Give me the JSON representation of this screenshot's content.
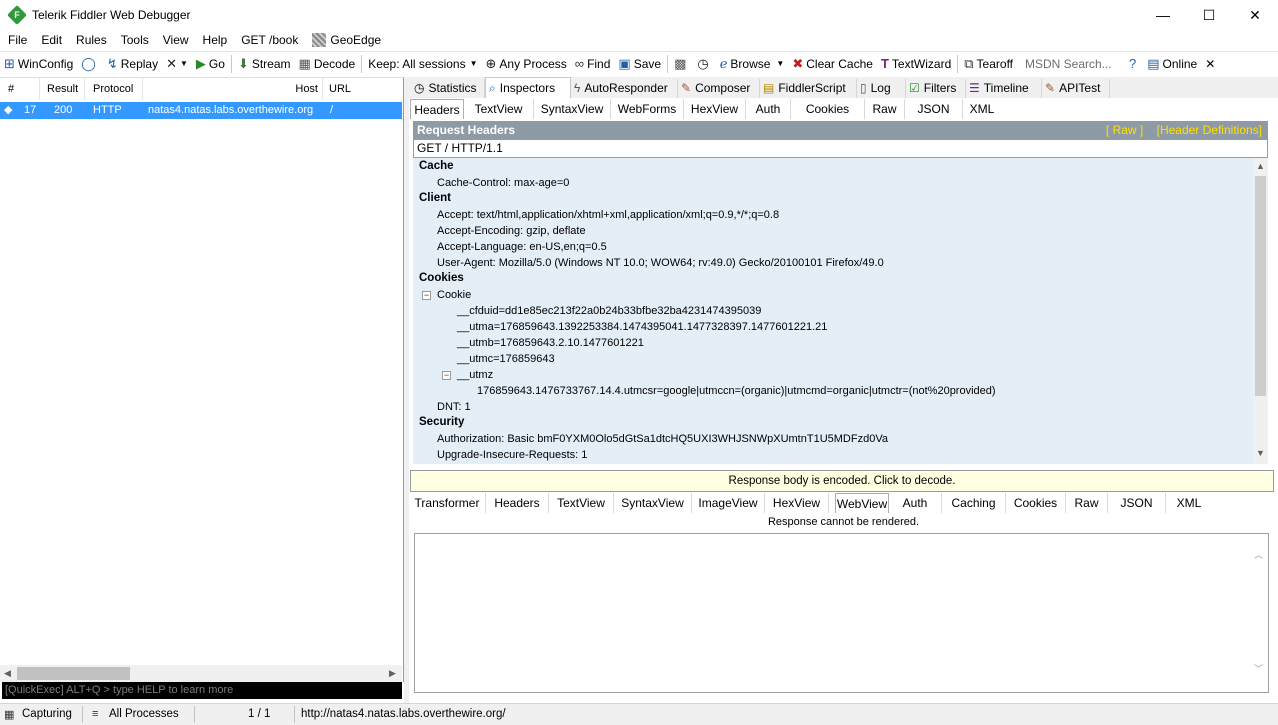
{
  "window": {
    "title": "Telerik Fiddler Web Debugger",
    "logo_letter": "F",
    "minimize": "—",
    "maximize": "☐",
    "close": "✕"
  },
  "menu": [
    "File",
    "Edit",
    "Rules",
    "Tools",
    "View",
    "Help",
    "GET /book",
    "GeoEdge"
  ],
  "toolbar": {
    "winconfig": "WinConfig",
    "replay": "Replay",
    "go": "Go",
    "stream": "Stream",
    "decode": "Decode",
    "keep": "Keep: All sessions",
    "any_process": "Any Process",
    "find": "Find",
    "save": "Save",
    "browse": "Browse",
    "clear_cache": "Clear Cache",
    "textwizard": "TextWizard",
    "tearoff": "Tearoff",
    "msdn_placeholder": "MSDN Search...",
    "online": "Online"
  },
  "sessions": {
    "columns": [
      "#",
      "Result",
      "Protocol",
      "Host",
      "URL"
    ],
    "rows": [
      {
        "num": "17",
        "result": "200",
        "protocol": "HTTP",
        "host": "natas4.natas.labs.overthewire.org",
        "url": "/"
      }
    ]
  },
  "quickexec": "[QuickExec] ALT+Q > type HELP to learn more",
  "status": {
    "capturing": "Capturing",
    "processes": "All Processes",
    "count": "1 / 1",
    "url": "http://natas4.natas.labs.overthewire.org/"
  },
  "main_tabs": [
    "Statistics",
    "Inspectors",
    "AutoResponder",
    "Composer",
    "FiddlerScript",
    "Log",
    "Filters",
    "Timeline",
    "APITest"
  ],
  "request_tabs": [
    "Headers",
    "TextView",
    "SyntaxView",
    "WebForms",
    "HexView",
    "Auth",
    "Cookies",
    "Raw",
    "JSON",
    "XML"
  ],
  "request": {
    "section_title": "Request Headers",
    "raw_link": "[ Raw ]",
    "defs_link": "[Header Definitions]",
    "request_line": "GET / HTTP/1.1",
    "groups": {
      "cache": "Cache",
      "client": "Client",
      "cookies": "Cookies",
      "security": "Security"
    },
    "lines": {
      "cache_control": "Cache-Control: max-age=0",
      "accept": "Accept: text/html,application/xhtml+xml,application/xml;q=0.9,*/*;q=0.8",
      "accept_encoding": "Accept-Encoding: gzip, deflate",
      "accept_language": "Accept-Language: en-US,en;q=0.5",
      "user_agent": "User-Agent: Mozilla/5.0 (Windows NT 10.0; WOW64; rv:49.0) Gecko/20100101 Firefox/49.0",
      "cookie": "Cookie",
      "cfduid": "__cfduid=dd1e85ec213f22a0b24b33bfbe32ba4231474395039",
      "utma": "__utma=176859643.1392253384.1474395041.1477328397.1477601221.21",
      "utmb": "__utmb=176859643.2.10.1477601221",
      "utmc": "__utmc=176859643",
      "utmz": "__utmz",
      "utmz_value": "176859643.1476733767.14.4.utmcsr=google|utmccn=(organic)|utmcmd=organic|utmctr=(not%20provided)",
      "dnt": "DNT: 1",
      "authorization": "Authorization: Basic bmF0YXM0Olo5dGtSa1dtcHQ5UXI3WHJSNWpXUmtnT1U5MDFzd0Va",
      "upgrade": "Upgrade-Insecure-Requests: 1"
    }
  },
  "response": {
    "encoded_notice": "Response body is encoded. Click to decode.",
    "tabs": [
      "Transformer",
      "Headers",
      "TextView",
      "SyntaxView",
      "ImageView",
      "HexView",
      "WebView",
      "Auth",
      "Caching",
      "Cookies",
      "Raw",
      "JSON",
      "XML"
    ],
    "cannot_render": "Response cannot be rendered."
  }
}
